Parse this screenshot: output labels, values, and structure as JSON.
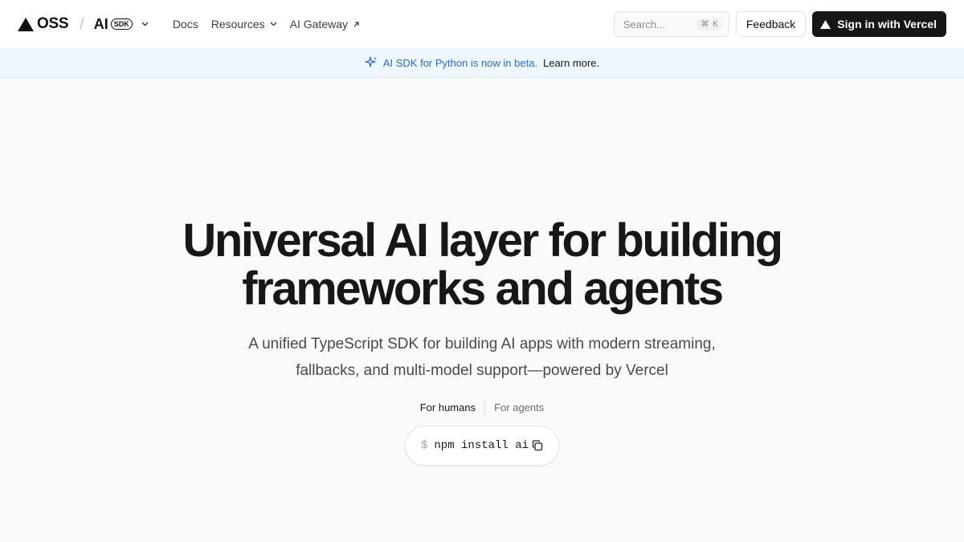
{
  "header": {
    "brand": "OSS",
    "product_name": "AI",
    "product_badge": "SDK",
    "nav": [
      {
        "label": "Docs",
        "icon": ""
      },
      {
        "label": "Resources",
        "icon": "chevron-down-icon"
      },
      {
        "label": "AI Gateway",
        "icon": "arrow-up-right-icon"
      }
    ],
    "search_placeholder": "Search...",
    "search_shortcut": "⌘ K",
    "feedback_label": "Feedback",
    "signin_label": "Sign in with Vercel"
  },
  "banner": {
    "text": "AI SDK for Python is now in beta.",
    "link_label": "Learn more.",
    "icon": "sparkle-icon"
  },
  "hero": {
    "title_line1": "Universal AI layer for building",
    "title_line2": "frameworks and agents",
    "subtitle_line1": "A unified TypeScript SDK for building AI apps with modern streaming,",
    "subtitle_line2": "fallbacks, and multi-model support—powered by Vercel",
    "audience_tabs": [
      "For humans",
      "For agents"
    ],
    "active_tab": "For humans",
    "install_prompt": "$",
    "install_command": "npm install ai"
  },
  "colors": {
    "background": "#fafafa",
    "banner_bg": "#eef6fe",
    "banner_text": "#2a6bd2",
    "primary_button": "#171717"
  }
}
